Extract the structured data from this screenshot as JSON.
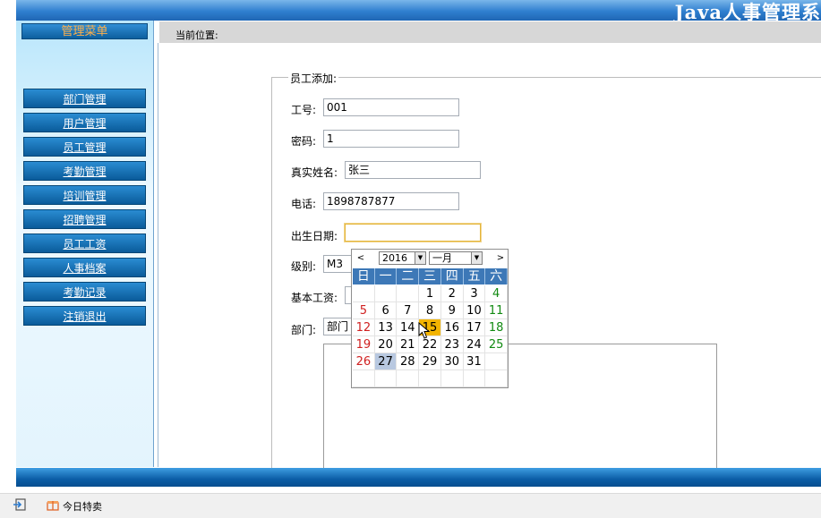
{
  "app": {
    "title": "Java人事管理系"
  },
  "sidebar": {
    "title": "管理菜单",
    "items": [
      {
        "label": "部门管理"
      },
      {
        "label": "用户管理"
      },
      {
        "label": "员工管理"
      },
      {
        "label": "考勤管理"
      },
      {
        "label": "培训管理"
      },
      {
        "label": "招聘管理"
      },
      {
        "label": "员工工资"
      },
      {
        "label": "人事档案"
      },
      {
        "label": "考勤记录"
      },
      {
        "label": "注销退出"
      }
    ]
  },
  "breadcrumb": {
    "label": "当前位置:"
  },
  "form": {
    "legend": "员工添加:",
    "fields": {
      "emp_no": {
        "label": "工号:",
        "value": "001"
      },
      "password": {
        "label": "密码:",
        "value": "1"
      },
      "real_name": {
        "label": "真实姓名:",
        "value": "张三"
      },
      "phone": {
        "label": "电话:",
        "value": "1898787877"
      },
      "dob": {
        "label": "出生日期:",
        "value": ""
      },
      "level": {
        "label": "级别:",
        "value": "M3"
      },
      "salary": {
        "label": "基本工资:",
        "value": ""
      },
      "dept": {
        "label": "部门:",
        "value": "部门"
      }
    }
  },
  "calendar": {
    "prev": "<",
    "next": ">",
    "year": "2016",
    "month": "一月",
    "weekdays": [
      "日",
      "一",
      "二",
      "三",
      "四",
      "五",
      "六"
    ],
    "weeks": [
      [
        "",
        "",
        "",
        "1",
        "2",
        "3",
        "4"
      ],
      [
        "5",
        "6",
        "7",
        "8",
        "9",
        "10",
        "11"
      ],
      [
        "12",
        "13",
        "14",
        "15",
        "16",
        "17",
        "18"
      ],
      [
        "19",
        "20",
        "21",
        "22",
        "23",
        "24",
        "25"
      ],
      [
        "26",
        "27",
        "28",
        "29",
        "30",
        "31",
        ""
      ],
      [
        "",
        "",
        "",
        "",
        "",
        "",
        ""
      ]
    ],
    "today": "15",
    "selected": "27",
    "colors": {
      "sunday": "#d02020",
      "saturday": "#118a11",
      "today_bg": "#f3b400",
      "selected_bg": "#b8c8e0",
      "header_bg": "#3d78b7"
    }
  },
  "taskbar": {
    "label": "今日特卖"
  }
}
